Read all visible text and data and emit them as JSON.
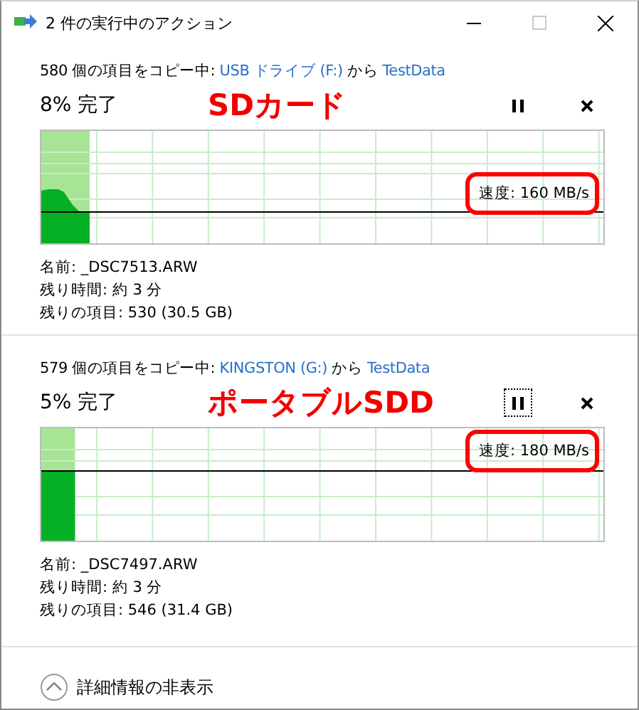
{
  "window": {
    "title": "2 件の実行中のアクション",
    "maximize_disabled": true
  },
  "operations": [
    {
      "count_text": "580 個の項目をコピー中: ",
      "source": "USB ドライブ (F:)",
      "middle": " から ",
      "destination": "TestData",
      "percent": "8% 完了",
      "annotation": "SDカード",
      "pause_focused": false,
      "level": 0.086,
      "speed": "速度: 160 MB/s",
      "speed_highlighted": true,
      "kind": "sloped",
      "details": [
        "名前:  _DSC7513.ARW",
        "残り時間:  約 3 分",
        "残りの項目:  530 (30.5 GB)"
      ]
    },
    {
      "count_text": "579 個の項目をコピー中: ",
      "source": "KINGSTON (G:)",
      "middle": " から ",
      "destination": "TestData",
      "percent": "5% 完了",
      "annotation": "ポータブルSDD",
      "pause_focused": true,
      "level": 0.06,
      "speed": "速度: 180 MB/s",
      "speed_highlighted": true,
      "kind": "flat",
      "details": [
        "名前:  _DSC7497.ARW",
        "残り時間:  約 3 分",
        "残りの項目:  546 (31.4 GB)"
      ]
    }
  ],
  "footer": {
    "label": "詳細情報の非表示",
    "expanded": true
  }
}
